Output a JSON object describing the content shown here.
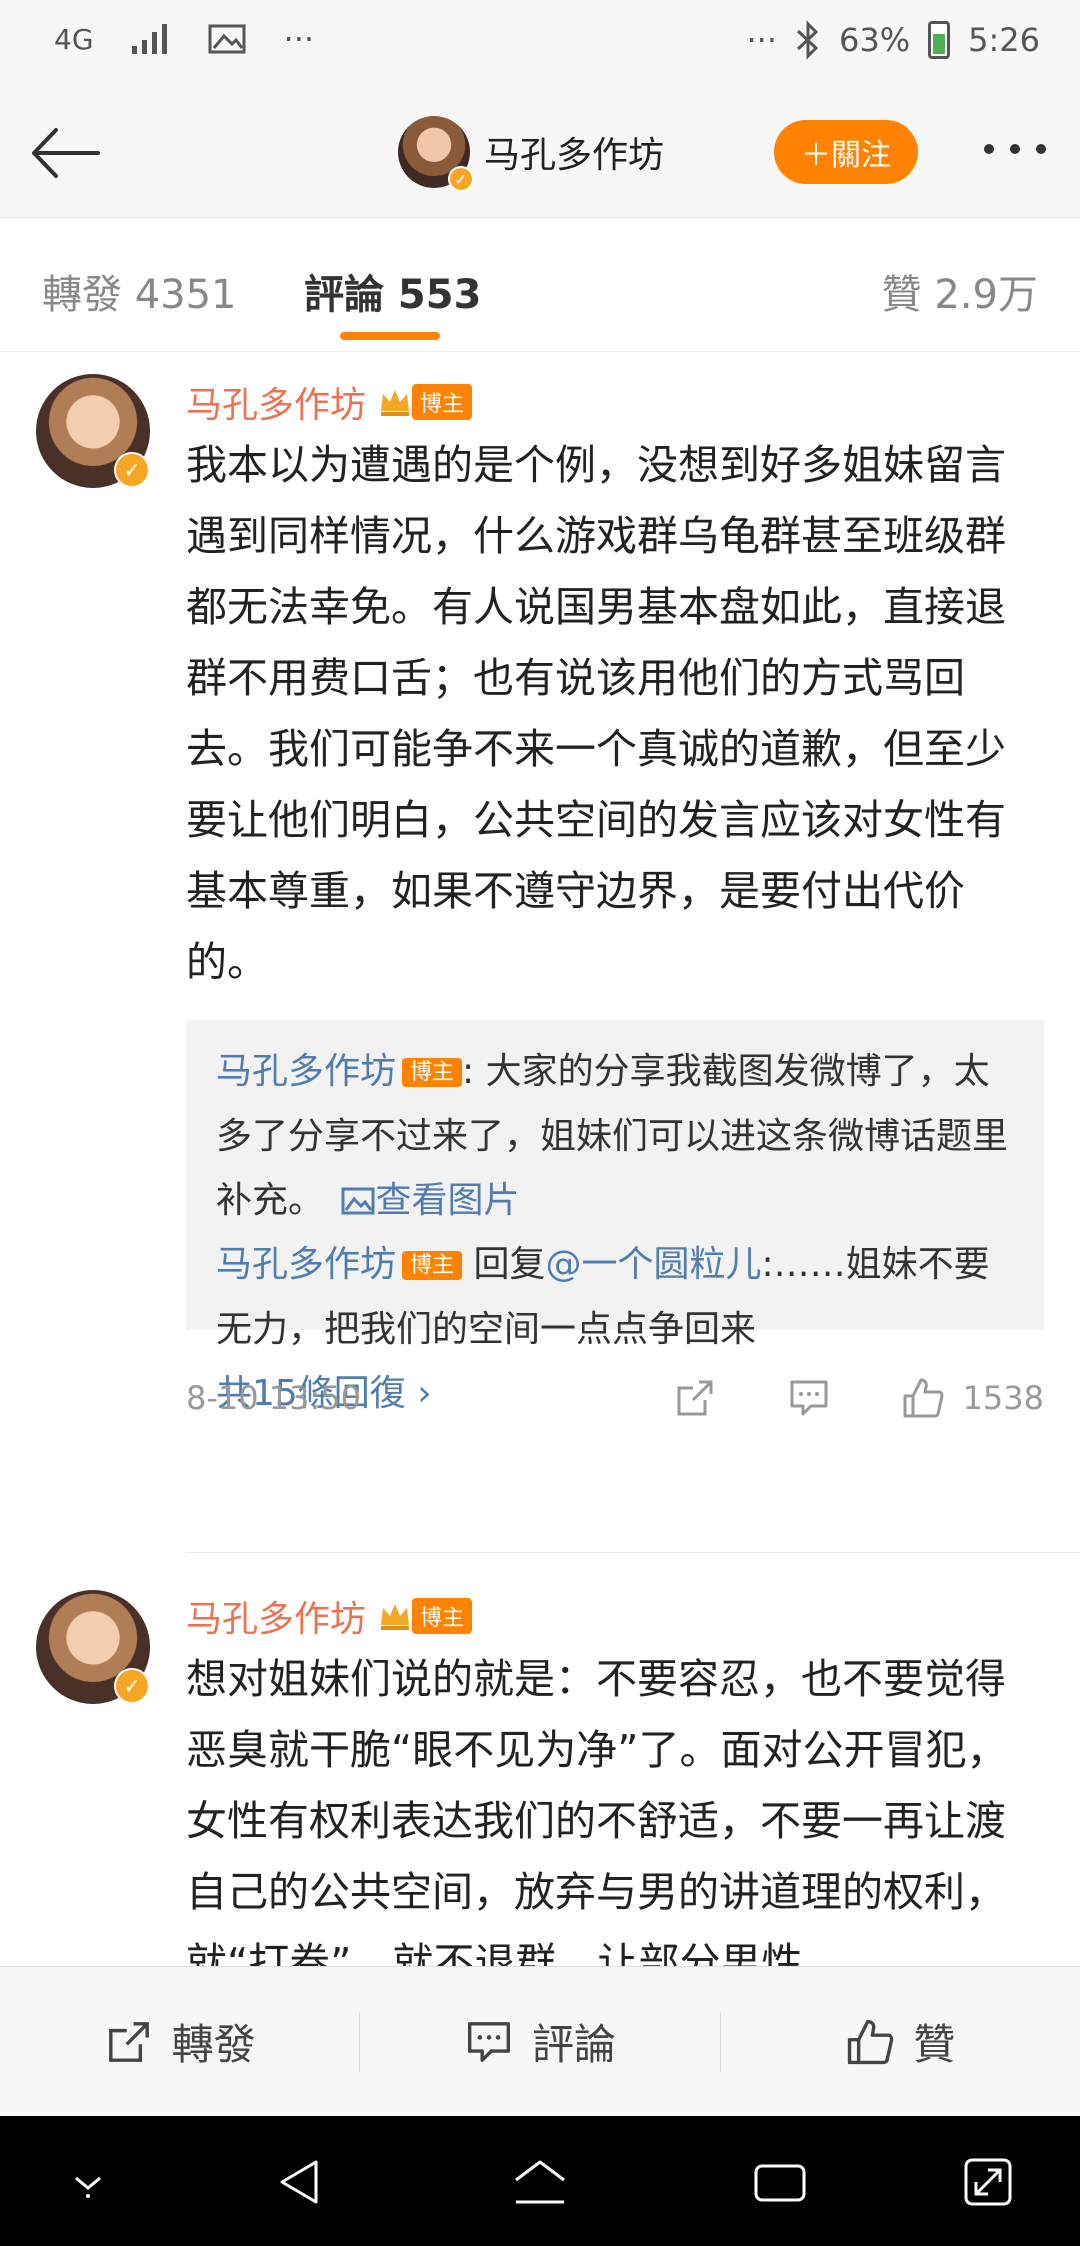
{
  "status": {
    "network": "4G",
    "dots_left": "···",
    "dots_right": "···",
    "battery": "63%",
    "time": "5:26"
  },
  "header": {
    "title": "马孔多作坊",
    "follow_label": "＋關注"
  },
  "tabs": [
    {
      "label": "轉發 4351"
    },
    {
      "label": "評論 553"
    },
    {
      "label": "贊 2.9万"
    }
  ],
  "comments": [
    {
      "author": "马孔多作坊",
      "badge": "博主",
      "text": "我本以为遭遇的是个例，没想到好多姐妹留言遇到同样情况，什么游戏群乌龟群甚至班级群都无法幸免。有人说国男基本盘如此，直接退群不用费口舌；也有说该用他们的方式骂回去。我们可能争不来一个真诚的道歉，但至少要让他们明白，公共空间的发言应该对女性有基本尊重，如果不遵守边界，是要付出代价的。",
      "replies": [
        {
          "author": "马孔多作坊",
          "badge": "博主",
          "text": ": 大家的分享我截图发微博了，太多了分享不过来了，姐妹们可以进这条微博话题里补充。",
          "link": "查看图片"
        },
        {
          "author": "马孔多作坊",
          "badge": "博主",
          "prefix": "回复",
          "mention": "@一个圆粒儿",
          "text": ":……姐妹不要无力，把我们的空间一点点争回来"
        }
      ],
      "total_replies": "共15條回復 ",
      "time": "8-10 13:50",
      "likes": "1538"
    },
    {
      "author": "马孔多作坊",
      "badge": "博主",
      "text": "想对姐妹们说的就是：不要容忍，也不要觉得恶臭就干脆“眼不见为净”了。面对公开冒犯，女性有权利表达我们的不舒适，不要一再让渡自己的公共空间，放弃与男的讲道理的权利，就“打卷”，就不退群，让部分男性"
    }
  ],
  "actions": [
    {
      "label": "轉發"
    },
    {
      "label": "評論"
    },
    {
      "label": "贊"
    }
  ]
}
